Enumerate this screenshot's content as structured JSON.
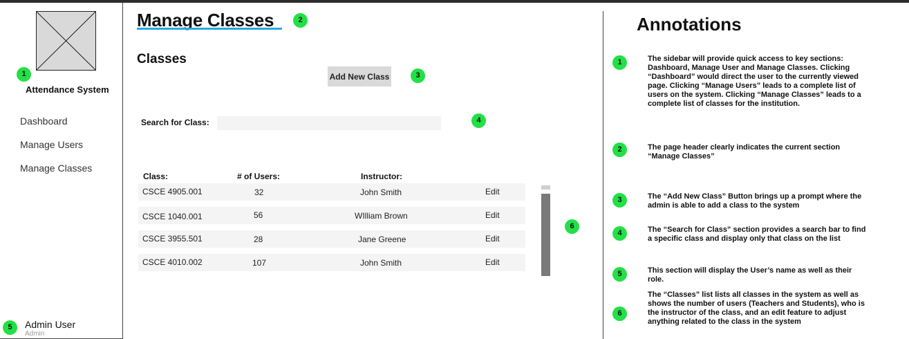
{
  "sidebar": {
    "app_title": "Attendance System",
    "logo_icon": "image-placeholder-icon",
    "nav": [
      {
        "label": "Dashboard"
      },
      {
        "label": "Manage Users"
      },
      {
        "label": "Manage Classes"
      }
    ],
    "user": {
      "name": "Admin User",
      "role": "Admin"
    }
  },
  "main": {
    "page_title": "Manage Classes",
    "section_title": "Classes",
    "add_button_label": "Add New Class",
    "search": {
      "label": "Search for Class:",
      "value": "",
      "placeholder": ""
    },
    "table": {
      "headers": {
        "class": "Class:",
        "users": "# of Users:",
        "instructor": "Instructor:"
      },
      "edit_label": "Edit",
      "rows": [
        {
          "class": "CSCE 4905.001",
          "users": "32",
          "instructor": "John Smith"
        },
        {
          "class": "CSCE 1040.001",
          "users": "56",
          "instructor": "WIlliam Brown"
        },
        {
          "class": "CSCE 3955.501",
          "users": "28",
          "instructor": "Jane Greene"
        },
        {
          "class": "CSCE 4010.002",
          "users": "107",
          "instructor": "John Smith"
        }
      ]
    }
  },
  "badges": {
    "b1": "1",
    "b2": "2",
    "b3": "3",
    "b4": "4",
    "b5": "5",
    "b6": "6"
  },
  "annotations": {
    "title": "Annotations",
    "items": [
      {
        "num": "1",
        "text": "The sidebar will provide quick access to key sections: Dashboard, Manage User and Manage Classes. Clicking “Dashboard” would direct the user to the currently viewed page. Clicking “Manage Users” leads to a complete list of users on the system. Clicking “Manage Classes” leads to a complete list of classes for the institution."
      },
      {
        "num": "2",
        "text": "The page header clearly indicates the current section “Manage Classes”"
      },
      {
        "num": "3",
        "text": "The “Add New Class” Button brings up a prompt where the admin is able to add a class to the system"
      },
      {
        "num": "4",
        "text": "The “Search for Class” section provides a search bar to find a specific class and display only that class on the list"
      },
      {
        "num": "5",
        "text": "This section will display the User’s name as well as their role."
      },
      {
        "num": "6",
        "text": "The “Classes” list lists all classes in the system as well as shows the number of users (Teachers and Students), who is the instructor of the class, and an edit feature to adjust anything related to the class in the system"
      }
    ]
  },
  "colors": {
    "badge": "#22e046",
    "title_underline": "#2aa7e6",
    "row_background": "#f4f4f4",
    "button_background": "#d9d9d9"
  }
}
